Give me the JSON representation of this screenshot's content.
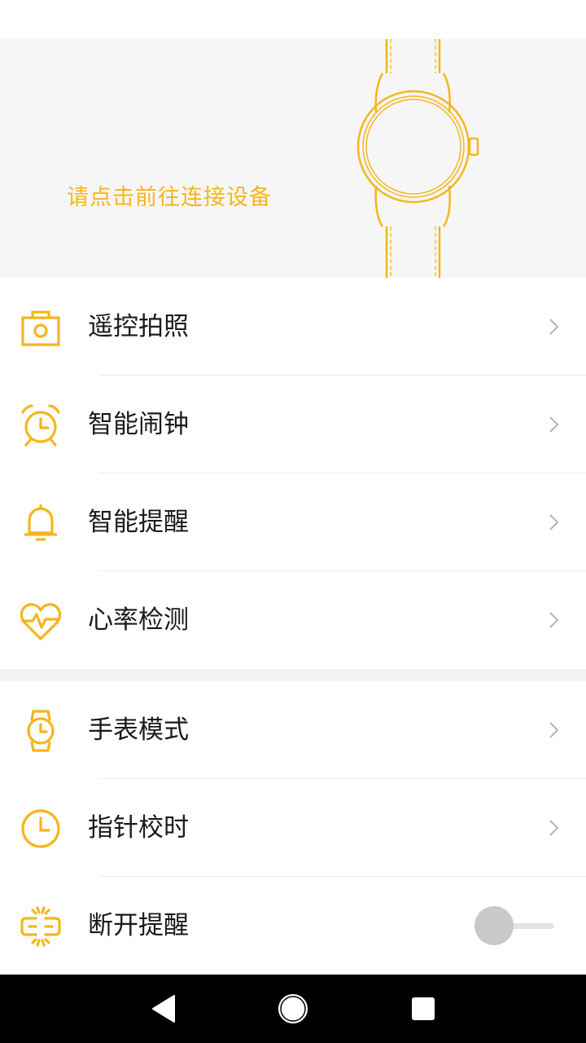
{
  "banner": {
    "connect_prompt": "请点击前往连接设备",
    "illustration_icon": "watch-outline-icon"
  },
  "colors": {
    "accent": "#f6b51c",
    "background": "#ffffff",
    "banner_background": "#f6f6f6",
    "text_primary": "#1a1a1a",
    "chevron": "#b5b5b5"
  },
  "menu_group_1": [
    {
      "label": "遥控拍照",
      "icon": "camera-icon"
    },
    {
      "label": "智能闹钟",
      "icon": "alarm-clock-icon"
    },
    {
      "label": "智能提醒",
      "icon": "bell-icon"
    },
    {
      "label": "心率检测",
      "icon": "heart-rate-icon"
    }
  ],
  "menu_group_2": [
    {
      "label": "手表模式",
      "icon": "watch-icon"
    },
    {
      "label": "指针校时",
      "icon": "clock-icon"
    },
    {
      "label": "断开提醒",
      "icon": "disconnect-icon",
      "toggle_on": false
    }
  ],
  "nav_bar": {
    "back": "back-triangle-icon",
    "home": "home-circle-icon",
    "recents": "recents-square-icon"
  }
}
